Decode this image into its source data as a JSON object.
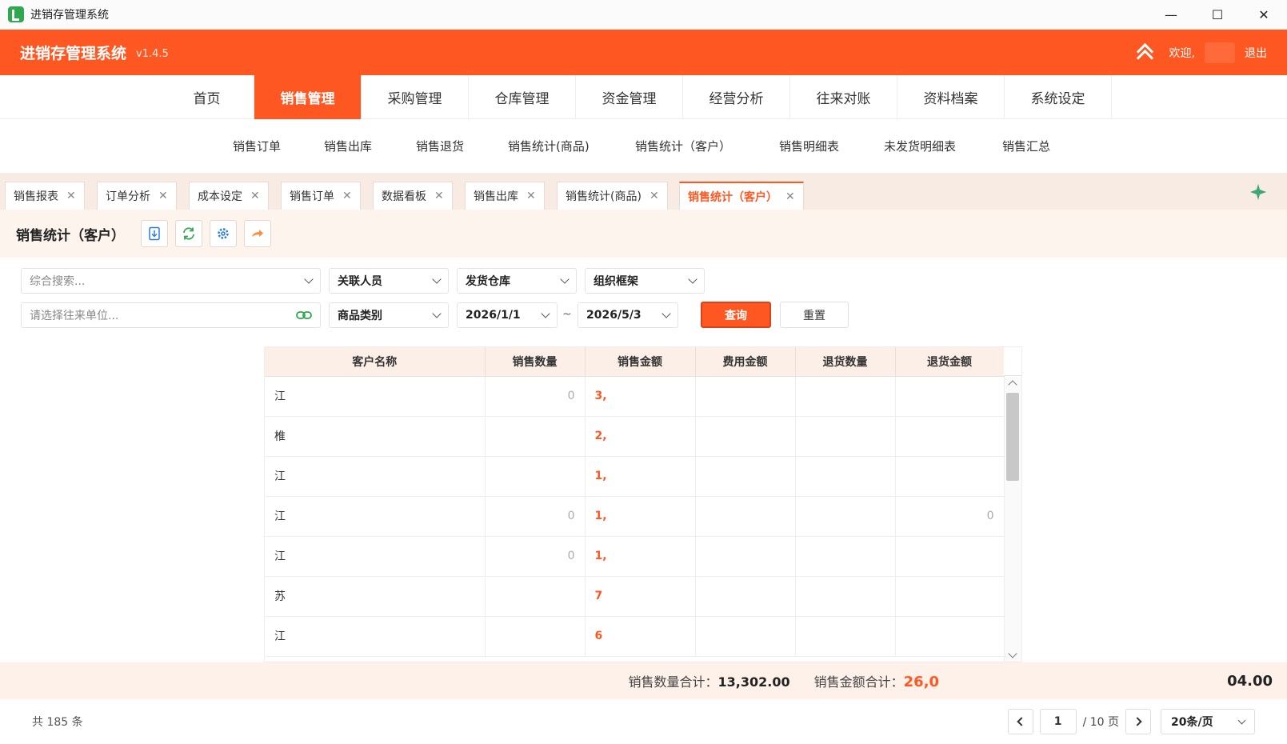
{
  "window": {
    "title": "进销存管理系统",
    "minimize_glyph": "—",
    "maximize_glyph": "☐",
    "close_glyph": "✕"
  },
  "header": {
    "app_name": "进销存管理系统",
    "version": "v1.4.5",
    "welcome": "欢迎,",
    "logout": "退出"
  },
  "main_nav": [
    {
      "label": "首页"
    },
    {
      "label": "销售管理",
      "active": true
    },
    {
      "label": "采购管理"
    },
    {
      "label": "仓库管理"
    },
    {
      "label": "资金管理"
    },
    {
      "label": "经营分析"
    },
    {
      "label": "往来对账"
    },
    {
      "label": "资料档案"
    },
    {
      "label": "系统设定"
    }
  ],
  "sub_nav": [
    "销售订单",
    "销售出库",
    "销售退货",
    "销售统计(商品)",
    "销售统计（客户）",
    "销售明细表",
    "未发货明细表",
    "销售汇总"
  ],
  "tabs": [
    {
      "label": "销售报表"
    },
    {
      "label": "订单分析"
    },
    {
      "label": "成本设定"
    },
    {
      "label": "销售订单"
    },
    {
      "label": "数据看板"
    },
    {
      "label": "销售出库"
    },
    {
      "label": "销售统计(商品)"
    },
    {
      "label": "销售统计（客户）",
      "active": true
    }
  ],
  "page": {
    "title": "销售统计（客户）"
  },
  "filters": {
    "search_placeholder": "综合搜索...",
    "related_person": "关联人员",
    "warehouse": "发货仓库",
    "org": "组织框架",
    "partner_placeholder": "请选择往来单位...",
    "product_category": "商品类别",
    "date_from": "2026/1/1",
    "date_sep": "~",
    "date_to": "2026/5/3",
    "query": "查询",
    "reset": "重置"
  },
  "table": {
    "columns": [
      "客户名称",
      "销售数量",
      "销售金额",
      "费用金额",
      "退货数量",
      "退货金额"
    ],
    "rows": [
      {
        "name": "江",
        "qty": "0",
        "amount": "3,",
        "fee": "",
        "rq": "",
        "ra": ""
      },
      {
        "name": "椎",
        "qty": "",
        "amount": "2,",
        "fee": "",
        "rq": "",
        "ra": ""
      },
      {
        "name": "江",
        "qty": "",
        "amount": "1,",
        "fee": "",
        "rq": "",
        "ra": ""
      },
      {
        "name": "江",
        "qty": "0",
        "amount": "1,",
        "fee": "",
        "rq": "",
        "ra": "0"
      },
      {
        "name": "江",
        "qty": "0",
        "amount": "1,",
        "fee": "",
        "rq": "",
        "ra": ""
      },
      {
        "name": "苏",
        "qty": "",
        "amount": "7",
        "fee": "",
        "rq": "",
        "ra": ""
      },
      {
        "name": "江",
        "qty": "",
        "amount": "6",
        "fee": "",
        "rq": "",
        "ra": ""
      }
    ]
  },
  "summary": {
    "qty_label": "销售数量合计：",
    "qty_value": "13,302.00",
    "amount_label": "销售金额合计：",
    "amount_value": "26,0",
    "last_value": "04.00"
  },
  "footer": {
    "total": "共 185 条",
    "page": "1",
    "page_total": "/ 10 页",
    "page_size": "20条/页"
  },
  "colors": {
    "accent": "#ff5722"
  }
}
